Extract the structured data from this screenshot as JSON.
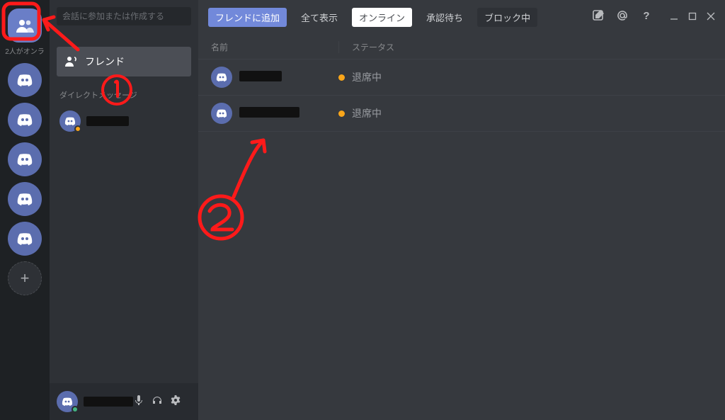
{
  "guilds": {
    "online_status": "2人がオンラ"
  },
  "sidebar": {
    "search_placeholder": "会話に参加または作成する",
    "friends_label": "フレンド",
    "dm_label": "ダイレクトメッセージ"
  },
  "user_panel": {
    "name": ""
  },
  "topbar": {
    "add_friend": "フレンドに追加",
    "all": "全て表示",
    "online": "オンライン",
    "pending": "承認待ち",
    "blocked": "ブロック中"
  },
  "columns": {
    "name": "名前",
    "status": "ステータス"
  },
  "status_labels": {
    "idle": "退席中"
  },
  "friends": [
    {
      "status": "idle",
      "name_mask_w": 60
    },
    {
      "status": "idle",
      "name_mask_w": 85
    }
  ],
  "colors": {
    "idle": "#faa61a",
    "online": "#43b581",
    "annotation": "#ff1a1a"
  },
  "annotations": {
    "circle1": "1",
    "circle2": "2"
  }
}
